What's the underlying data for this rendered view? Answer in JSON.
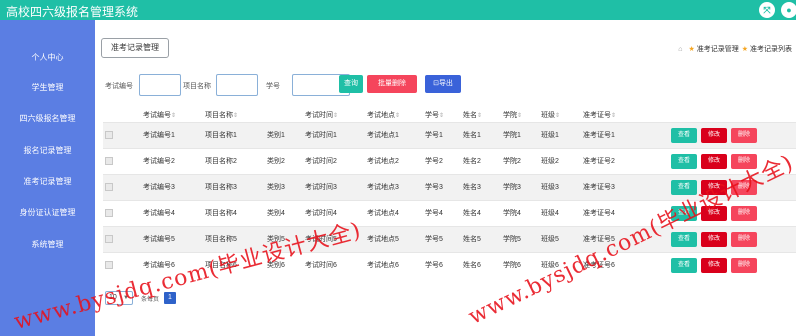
{
  "app": {
    "title": "高校四六级报名管理系统"
  },
  "header": {
    "icons": [
      "collapse-icon",
      "user-icon"
    ]
  },
  "sidebar": {
    "items": [
      {
        "label": "个人中心"
      },
      {
        "label": "学生管理"
      },
      {
        "label": "四六级报名管理"
      },
      {
        "label": "报名记录管理"
      },
      {
        "label": "准考记录管理"
      },
      {
        "label": "身份证认证管理"
      },
      {
        "label": "系统管理"
      }
    ]
  },
  "tab": {
    "label": "准考记录管理"
  },
  "breadcrumb": {
    "item1": "准考记录管理",
    "item2": "准考记录列表"
  },
  "search": {
    "exam_no_label": "考试编号",
    "project_name_label": "项目名称",
    "student_no_label": "学号",
    "query_button": "查询",
    "batch_delete_button": "批量删除",
    "export_button": "导出"
  },
  "table": {
    "columns": [
      "考试编号",
      "项目名称",
      "类别",
      "考试时间",
      "考试地点",
      "学号",
      "姓名",
      "学院",
      "班级",
      "准考证号"
    ],
    "rows": [
      [
        "考试编号1",
        "项目名称1",
        "类别1",
        "考试时间1",
        "考试地点1",
        "学号1",
        "姓名1",
        "学院1",
        "班级1",
        "准考证号1"
      ],
      [
        "考试编号2",
        "项目名称2",
        "类别2",
        "考试时间2",
        "考试地点2",
        "学号2",
        "姓名2",
        "学院2",
        "班级2",
        "准考证号2"
      ],
      [
        "考试编号3",
        "项目名称3",
        "类别3",
        "考试时间3",
        "考试地点3",
        "学号3",
        "姓名3",
        "学院3",
        "班级3",
        "准考证号3"
      ],
      [
        "考试编号4",
        "项目名称4",
        "类别4",
        "考试时间4",
        "考试地点4",
        "学号4",
        "姓名4",
        "学院4",
        "班级4",
        "准考证号4"
      ],
      [
        "考试编号5",
        "项目名称5",
        "类别5",
        "考试时间5",
        "考试地点5",
        "学号5",
        "姓名5",
        "学院5",
        "班级5",
        "准考证号5"
      ],
      [
        "考试编号6",
        "项目名称6",
        "类别6",
        "考试时间6",
        "考试地点6",
        "学号6",
        "姓名6",
        "学院6",
        "班级6",
        "准考证号6"
      ]
    ],
    "actions": {
      "view": "查看",
      "edit": "修改",
      "delete": "删除"
    }
  },
  "pagination": {
    "page_size": "10",
    "total": "条每页",
    "current_page": "1"
  },
  "watermark": {
    "text": "www.bysjdq.com(毕业设计大全)"
  },
  "colors": {
    "header": "#1fbfa6",
    "sidebar": "#5b7ee3",
    "query": "#1fbfa6",
    "batch_delete": "#f5455c",
    "export": "#3a62d9",
    "watermark": "#e8101a"
  }
}
